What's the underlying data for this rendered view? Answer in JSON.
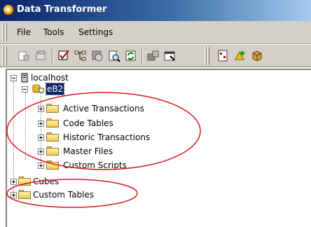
{
  "window": {
    "title": "Data Transformer"
  },
  "menu": {
    "items": [
      "File",
      "Tools",
      "Settings"
    ]
  },
  "toolbar": {
    "icons": [
      "new-icon",
      "open-icon",
      "check-icon",
      "tree-icon",
      "refresh-icon",
      "preview-icon",
      "sync-icon",
      "export-icon",
      "properties-icon",
      "report-icon",
      "build-icon",
      "cube-icon"
    ]
  },
  "tree": {
    "root": "localhost",
    "database": "eB2",
    "folders": [
      "Active Transactions",
      "Code Tables",
      "Historic Transactions",
      "Master Files",
      "Custom Scripts"
    ],
    "top_level": [
      "Cubes",
      "Custom Tables"
    ]
  },
  "annotations": {
    "color": "#e0141e"
  }
}
